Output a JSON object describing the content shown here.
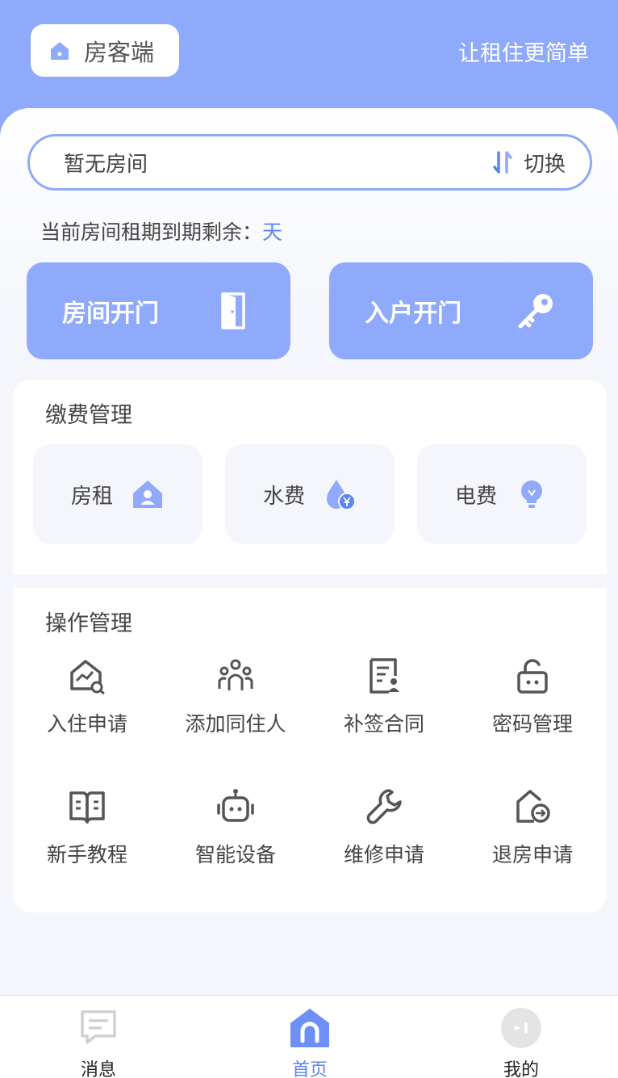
{
  "header": {
    "app_name": "房客端",
    "slogan": "让租住更简单"
  },
  "room": {
    "current": "暂无房间",
    "switch_label": "切换"
  },
  "lease": {
    "prefix": "当前房间租期到期剩余：",
    "days_unit": "天"
  },
  "doors": {
    "room_door": "房间开门",
    "entry_door": "入户开门"
  },
  "payment": {
    "title": "缴费管理",
    "items": [
      {
        "label": "房租",
        "icon": "house-person-icon"
      },
      {
        "label": "水费",
        "icon": "water-drop-yen-icon"
      },
      {
        "label": "电费",
        "icon": "lightbulb-icon"
      }
    ]
  },
  "operations": {
    "title": "操作管理",
    "items": [
      {
        "label": "入住申请",
        "icon": "house-chart-icon"
      },
      {
        "label": "添加同住人",
        "icon": "people-icon"
      },
      {
        "label": "补签合同",
        "icon": "contract-icon"
      },
      {
        "label": "密码管理",
        "icon": "lock-icon"
      },
      {
        "label": "新手教程",
        "icon": "book-icon"
      },
      {
        "label": "智能设备",
        "icon": "robot-icon"
      },
      {
        "label": "维修申请",
        "icon": "wrench-icon"
      },
      {
        "label": "退房申请",
        "icon": "house-exit-icon"
      }
    ]
  },
  "tabbar": {
    "items": [
      {
        "label": "消息",
        "icon": "message-icon",
        "active": false
      },
      {
        "label": "首页",
        "icon": "home-icon",
        "active": true
      },
      {
        "label": "我的",
        "icon": "profile-icon",
        "active": false
      }
    ]
  },
  "colors": {
    "primary": "#8fa9fb",
    "accent_text": "#5d84f0",
    "background": "#f4f6fb"
  }
}
